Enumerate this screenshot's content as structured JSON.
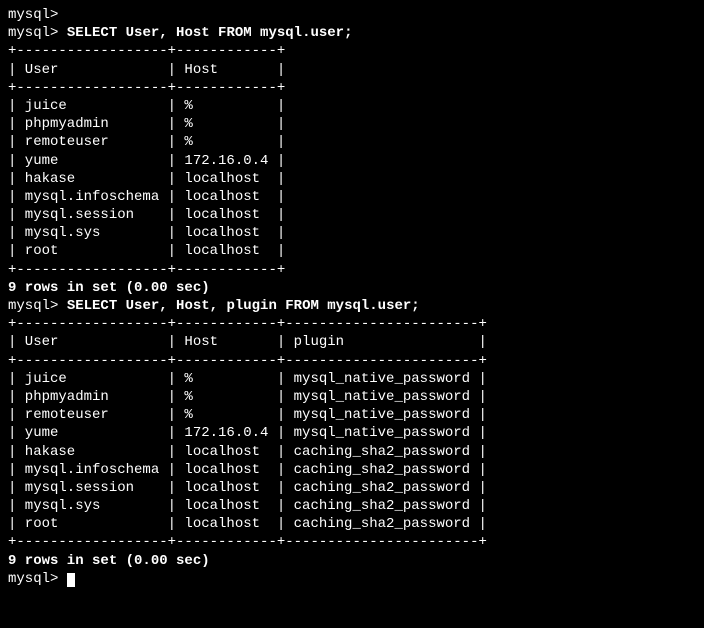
{
  "prompt": "mysql>",
  "query1": "SELECT User, Host FROM mysql.user;",
  "query2": "SELECT User, Host, plugin FROM mysql.user;",
  "table1": {
    "border": "+------------------+------------+",
    "header": "| User             | Host       |",
    "rows": [
      "| juice            | %          |",
      "| phpmyadmin       | %          |",
      "| remoteuser       | %          |",
      "| yume             | 172.16.0.4 |",
      "| hakase           | localhost  |",
      "| mysql.infoschema | localhost  |",
      "| mysql.session    | localhost  |",
      "| mysql.sys        | localhost  |",
      "| root             | localhost  |"
    ],
    "footer": "9 rows in set (0.00 sec)"
  },
  "table2": {
    "border": "+------------------+------------+-----------------------+",
    "header": "| User             | Host       | plugin                |",
    "rows": [
      "| juice            | %          | mysql_native_password |",
      "| phpmyadmin       | %          | mysql_native_password |",
      "| remoteuser       | %          | mysql_native_password |",
      "| yume             | 172.16.0.4 | mysql_native_password |",
      "| hakase           | localhost  | caching_sha2_password |",
      "| mysql.infoschema | localhost  | caching_sha2_password |",
      "| mysql.session    | localhost  | caching_sha2_password |",
      "| mysql.sys        | localhost  | caching_sha2_password |",
      "| root             | localhost  | caching_sha2_password |"
    ],
    "footer": "9 rows in set (0.00 sec)"
  },
  "blank": ""
}
